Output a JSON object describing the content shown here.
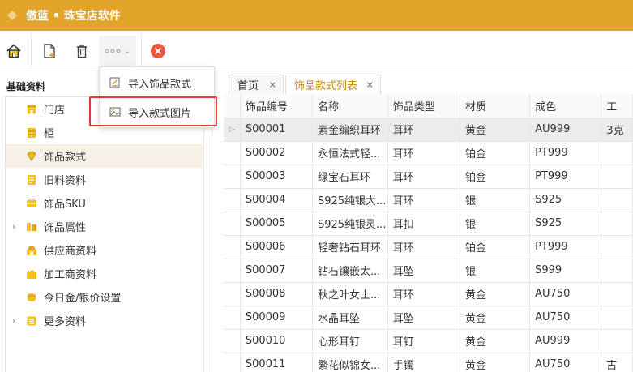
{
  "app": {
    "title": "傲蓝 • 珠宝店软件"
  },
  "toolbar": {
    "more_caret": "⌄"
  },
  "dropdown": {
    "items": [
      {
        "label": "导入饰品款式"
      },
      {
        "label": "导入款式图片"
      }
    ]
  },
  "sidebar": {
    "header": "基础资料",
    "items": [
      {
        "label": "门店",
        "icon": "store-icon"
      },
      {
        "label": "柜",
        "icon": "cabinet-icon"
      },
      {
        "label": "饰品款式",
        "icon": "jewelry-style-icon",
        "selected": true
      },
      {
        "label": "旧料资料",
        "icon": "old-material-icon"
      },
      {
        "label": "饰品SKU",
        "icon": "sku-icon"
      },
      {
        "label": "饰品属性",
        "icon": "attribute-icon",
        "expandable": true
      },
      {
        "label": "供应商资料",
        "icon": "supplier-icon"
      },
      {
        "label": "加工商资料",
        "icon": "processor-icon"
      },
      {
        "label": "今日金/银价设置",
        "icon": "price-icon"
      },
      {
        "label": "更多资料",
        "icon": "more-data-icon",
        "expandable": true
      }
    ],
    "arrow": "›"
  },
  "tabs": [
    {
      "label": "首页",
      "close": "×"
    },
    {
      "label": "饰品款式列表",
      "close": "×",
      "active": true
    }
  ],
  "table": {
    "columns": [
      "",
      "饰品编号",
      "名称",
      "饰品类型",
      "材质",
      "成色",
      "工"
    ],
    "current_row_marker": "▷",
    "rows": [
      [
        "S00001",
        "素金编织耳环",
        "耳环",
        "黄金",
        "AU999",
        "3克"
      ],
      [
        "S00002",
        "永恒法式轻...",
        "耳环",
        "铂金",
        "PT999",
        ""
      ],
      [
        "S00003",
        "绿宝石耳环",
        "耳环",
        "铂金",
        "PT999",
        ""
      ],
      [
        "S00004",
        "S925纯银大...",
        "耳环",
        "银",
        "S925",
        ""
      ],
      [
        "S00005",
        "S925纯银灵...",
        "耳扣",
        "银",
        "S925",
        ""
      ],
      [
        "S00006",
        "轻奢钻石耳环",
        "耳环",
        "铂金",
        "PT999",
        ""
      ],
      [
        "S00007",
        "钻石镶嵌太...",
        "耳坠",
        "银",
        "S999",
        ""
      ],
      [
        "S00008",
        "秋之叶女士...",
        "耳环",
        "黄金",
        "AU750",
        ""
      ],
      [
        "S00009",
        "水晶耳坠",
        "耳坠",
        "黄金",
        "AU750",
        ""
      ],
      [
        "S00010",
        "心形耳钉",
        "耳钉",
        "黄金",
        "AU999",
        ""
      ],
      [
        "S00011",
        "繁花似锦女...",
        "手镯",
        "黄金",
        "AU750",
        "古"
      ]
    ]
  }
}
